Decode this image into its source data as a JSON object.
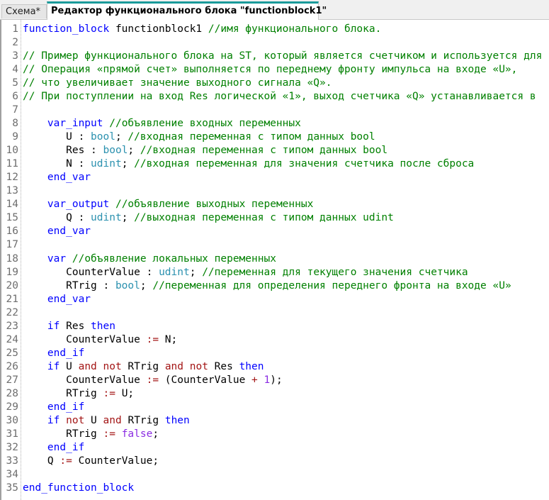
{
  "tabs": [
    {
      "label": "Схема*",
      "active": false
    },
    {
      "label": "Редактор функционального блока \"functionblock1\"",
      "active": true
    }
  ],
  "colors": {
    "keyword": "#0000ff",
    "type": "#2b91af",
    "comment": "#008000",
    "operator": "#a31515",
    "literal": "#8a2be2",
    "active_tab_accent": "#1a9a9a"
  },
  "code_lines": [
    {
      "n": "1",
      "tokens": [
        [
          "kw",
          "function_block"
        ],
        [
          "id",
          " functionblock1 "
        ],
        [
          "cm",
          "//имя функционального блока."
        ]
      ]
    },
    {
      "n": "2",
      "tokens": []
    },
    {
      "n": "3",
      "tokens": [
        [
          "cm",
          "// Пример функционального блока на ST, который является счетчиком и используется для"
        ]
      ]
    },
    {
      "n": "4",
      "tokens": [
        [
          "cm",
          "// Операция «прямой счет» выполняется по переднему фронту импульса на входе «U»,"
        ]
      ]
    },
    {
      "n": "5",
      "tokens": [
        [
          "cm",
          "// что увеличивает значение выходного сигнала «Q»."
        ]
      ]
    },
    {
      "n": "6",
      "tokens": [
        [
          "cm",
          "// При поступлении на вход Res логической «1», выход счетчика «Q» устанавливается в"
        ]
      ]
    },
    {
      "n": "7",
      "tokens": []
    },
    {
      "n": "8",
      "tokens": [
        [
          "id",
          "    "
        ],
        [
          "kw",
          "var_input"
        ],
        [
          "id",
          " "
        ],
        [
          "cm",
          "//объявление входных переменных"
        ]
      ]
    },
    {
      "n": "9",
      "tokens": [
        [
          "id",
          "       U : "
        ],
        [
          "type",
          "bool"
        ],
        [
          "id",
          "; "
        ],
        [
          "cm",
          "//входная переменная с типом данных bool"
        ]
      ]
    },
    {
      "n": "10",
      "tokens": [
        [
          "id",
          "       Res : "
        ],
        [
          "type",
          "bool"
        ],
        [
          "id",
          "; "
        ],
        [
          "cm",
          "//входная переменная с типом данных bool"
        ]
      ]
    },
    {
      "n": "11",
      "tokens": [
        [
          "id",
          "       N : "
        ],
        [
          "type",
          "udint"
        ],
        [
          "id",
          "; "
        ],
        [
          "cm",
          "//входная переменная для значения счетчика после сброса"
        ]
      ]
    },
    {
      "n": "12",
      "tokens": [
        [
          "id",
          "    "
        ],
        [
          "kw",
          "end_var"
        ]
      ]
    },
    {
      "n": "13",
      "tokens": []
    },
    {
      "n": "14",
      "tokens": [
        [
          "id",
          "    "
        ],
        [
          "kw",
          "var_output"
        ],
        [
          "id",
          " "
        ],
        [
          "cm",
          "//объявление выходных переменных"
        ]
      ]
    },
    {
      "n": "15",
      "tokens": [
        [
          "id",
          "       Q : "
        ],
        [
          "type",
          "udint"
        ],
        [
          "id",
          "; "
        ],
        [
          "cm",
          "//выходная переменная с типом данных udint"
        ]
      ]
    },
    {
      "n": "16",
      "tokens": [
        [
          "id",
          "    "
        ],
        [
          "kw",
          "end_var"
        ]
      ]
    },
    {
      "n": "17",
      "tokens": []
    },
    {
      "n": "18",
      "tokens": [
        [
          "id",
          "    "
        ],
        [
          "kw",
          "var"
        ],
        [
          "id",
          " "
        ],
        [
          "cm",
          "//объявление локальных переменных"
        ]
      ]
    },
    {
      "n": "19",
      "tokens": [
        [
          "id",
          "       CounterValue : "
        ],
        [
          "type",
          "udint"
        ],
        [
          "id",
          "; "
        ],
        [
          "cm",
          "//переменная для текущего значения счетчика"
        ]
      ]
    },
    {
      "n": "20",
      "tokens": [
        [
          "id",
          "       RTrig : "
        ],
        [
          "type",
          "bool"
        ],
        [
          "id",
          "; "
        ],
        [
          "cm",
          "//переменная для определения переднего фронта на входе «U»"
        ]
      ]
    },
    {
      "n": "21",
      "tokens": [
        [
          "id",
          "    "
        ],
        [
          "kw",
          "end_var"
        ]
      ]
    },
    {
      "n": "22",
      "tokens": []
    },
    {
      "n": "23",
      "tokens": [
        [
          "id",
          "    "
        ],
        [
          "kw",
          "if"
        ],
        [
          "id",
          " Res "
        ],
        [
          "kw",
          "then"
        ]
      ]
    },
    {
      "n": "24",
      "tokens": [
        [
          "id",
          "       CounterValue "
        ],
        [
          "op",
          ":="
        ],
        [
          "id",
          " N;"
        ]
      ]
    },
    {
      "n": "25",
      "tokens": [
        [
          "id",
          "    "
        ],
        [
          "kw",
          "end_if"
        ]
      ]
    },
    {
      "n": "26",
      "tokens": [
        [
          "id",
          "    "
        ],
        [
          "kw",
          "if"
        ],
        [
          "id",
          " U "
        ],
        [
          "op",
          "and not"
        ],
        [
          "id",
          " RTrig "
        ],
        [
          "op",
          "and not"
        ],
        [
          "id",
          " Res "
        ],
        [
          "kw",
          "then"
        ]
      ]
    },
    {
      "n": "27",
      "tokens": [
        [
          "id",
          "       CounterValue "
        ],
        [
          "op",
          ":="
        ],
        [
          "id",
          " (CounterValue "
        ],
        [
          "op",
          "+"
        ],
        [
          "id",
          " "
        ],
        [
          "num",
          "1"
        ],
        [
          "id",
          ");"
        ]
      ]
    },
    {
      "n": "28",
      "tokens": [
        [
          "id",
          "       RTrig "
        ],
        [
          "op",
          ":="
        ],
        [
          "id",
          " U;"
        ]
      ]
    },
    {
      "n": "29",
      "tokens": [
        [
          "id",
          "    "
        ],
        [
          "kw",
          "end_if"
        ]
      ]
    },
    {
      "n": "30",
      "tokens": [
        [
          "id",
          "    "
        ],
        [
          "kw",
          "if"
        ],
        [
          "id",
          " "
        ],
        [
          "op",
          "not"
        ],
        [
          "id",
          " U "
        ],
        [
          "op",
          "and"
        ],
        [
          "id",
          " RTrig "
        ],
        [
          "kw",
          "then"
        ]
      ]
    },
    {
      "n": "31",
      "tokens": [
        [
          "id",
          "       RTrig "
        ],
        [
          "op",
          ":="
        ],
        [
          "id",
          " "
        ],
        [
          "num",
          "false"
        ],
        [
          "id",
          ";"
        ]
      ]
    },
    {
      "n": "32",
      "tokens": [
        [
          "id",
          "    "
        ],
        [
          "kw",
          "end_if"
        ]
      ]
    },
    {
      "n": "33",
      "tokens": [
        [
          "id",
          "    Q "
        ],
        [
          "op",
          ":="
        ],
        [
          "id",
          " CounterValue;"
        ]
      ]
    },
    {
      "n": "34",
      "tokens": []
    },
    {
      "n": "35",
      "tokens": [
        [
          "kw",
          "end_function_block"
        ]
      ]
    }
  ]
}
